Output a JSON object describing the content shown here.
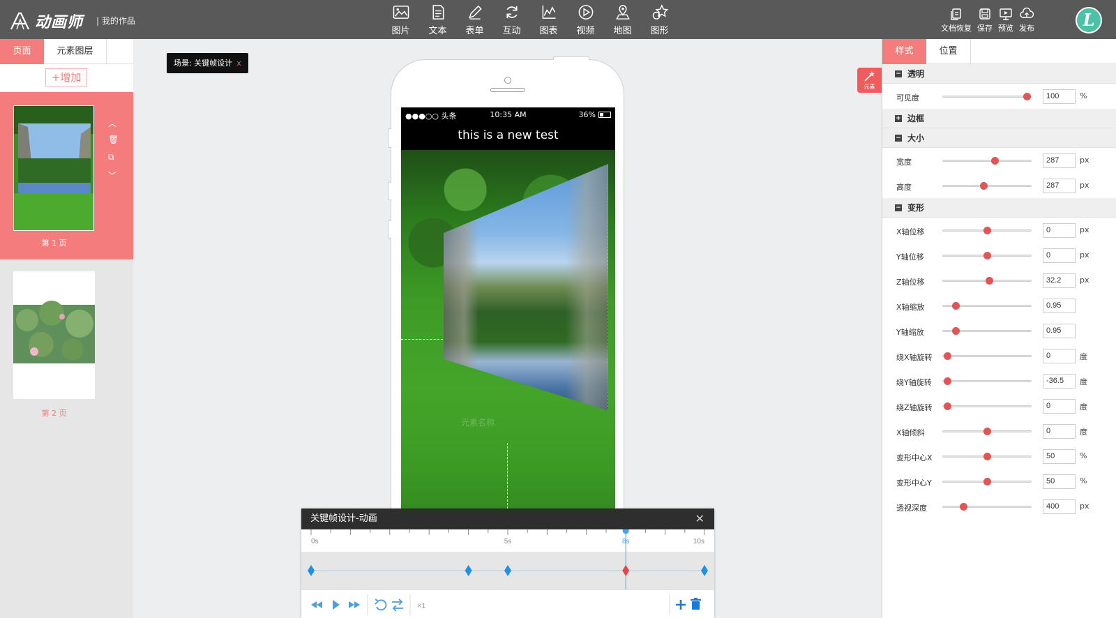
{
  "header": {
    "logo_text": "动画师",
    "my_works": "| 我的作品",
    "tools": [
      {
        "label": "图片",
        "icon": "image-icon"
      },
      {
        "label": "文本",
        "icon": "text-icon"
      },
      {
        "label": "表单",
        "icon": "form-icon"
      },
      {
        "label": "互动",
        "icon": "interact-icon"
      },
      {
        "label": "图表",
        "icon": "chart-icon"
      },
      {
        "label": "视频",
        "icon": "video-icon"
      },
      {
        "label": "地图",
        "icon": "map-icon"
      },
      {
        "label": "图形",
        "icon": "shape-icon"
      }
    ],
    "actions": [
      {
        "label": "文档恢复",
        "icon": "restore-icon"
      },
      {
        "label": "保存",
        "icon": "save-icon"
      },
      {
        "label": "预览",
        "icon": "preview-icon"
      },
      {
        "label": "发布",
        "icon": "publish-icon"
      }
    ],
    "avatar_letter": "L"
  },
  "left_panel": {
    "tabs": [
      "页面",
      "元素图层"
    ],
    "add_label": "+增加",
    "page_tools": [
      "︿",
      "🗑",
      "⧉",
      "﹀"
    ],
    "pages": [
      {
        "label": "第 1 页",
        "active": true
      },
      {
        "label": "第 2 页",
        "active": false
      }
    ]
  },
  "canvas": {
    "scene_label": "场景:  关键帧设计",
    "scene_close": "x",
    "status_left": "●●●○○ 头条",
    "status_time": "10:35 AM",
    "status_battery": "36%",
    "page_title": "this is a new test",
    "watermark": "元素名称",
    "element_pin_label": "元素"
  },
  "timeline": {
    "title": "关键帧设计-动画",
    "close": "✕",
    "ticks": [
      "0s",
      "5s",
      "8s",
      "10s"
    ],
    "duration_s": 10,
    "current_s": 8,
    "keyframes": [
      {
        "t": 0.0,
        "active": false
      },
      {
        "t": 4.0,
        "active": false
      },
      {
        "t": 5.0,
        "active": false
      },
      {
        "t": 8.0,
        "active": true
      },
      {
        "t": 10.0,
        "active": false
      }
    ],
    "speed": "×1",
    "accent": "#1e90e6",
    "active_color": "#e24848"
  },
  "right_panel": {
    "tabs": [
      "样式",
      "位置"
    ],
    "sections": [
      {
        "title": "透明",
        "collapsed": false,
        "rows": [
          {
            "label": "可见度",
            "value": "100",
            "unit": "%",
            "pos": 0.95
          }
        ]
      },
      {
        "title": "边框",
        "collapsed": true,
        "rows": []
      },
      {
        "title": "大小",
        "collapsed": false,
        "rows": [
          {
            "label": "宽度",
            "value": "287",
            "unit": "px",
            "pos": 0.59
          },
          {
            "label": "高度",
            "value": "287",
            "unit": "px",
            "pos": 0.46
          }
        ]
      },
      {
        "title": "变形",
        "collapsed": false,
        "rows": [
          {
            "label": "X轴位移",
            "value": "0",
            "unit": "px",
            "pos": 0.5
          },
          {
            "label": "Y轴位移",
            "value": "0",
            "unit": "px",
            "pos": 0.5
          },
          {
            "label": "Z轴位移",
            "value": "32.2",
            "unit": "px",
            "pos": 0.52
          },
          {
            "label": "X轴缩放",
            "value": "0.95",
            "unit": "",
            "pos": 0.14
          },
          {
            "label": "Y轴缩放",
            "value": "0.95",
            "unit": "",
            "pos": 0.14
          },
          {
            "label": "绕X轴旋转",
            "value": "0",
            "unit": "度",
            "pos": 0.05
          },
          {
            "label": "绕Y轴旋转",
            "value": "-36.5",
            "unit": "度",
            "pos": 0.05
          },
          {
            "label": "绕Z轴旋转",
            "value": "0",
            "unit": "度",
            "pos": 0.05
          },
          {
            "label": "X轴倾斜",
            "value": "0",
            "unit": "度",
            "pos": 0.5
          },
          {
            "label": "变形中心X",
            "value": "50",
            "unit": "%",
            "pos": 0.5
          },
          {
            "label": "变形中心Y",
            "value": "50",
            "unit": "%",
            "pos": 0.5
          },
          {
            "label": "透视深度",
            "value": "400",
            "unit": "px",
            "pos": 0.23
          }
        ]
      }
    ]
  },
  "colors": {
    "accent": "#f47c7c",
    "slider": "#e25555",
    "topbar": "#595959"
  }
}
